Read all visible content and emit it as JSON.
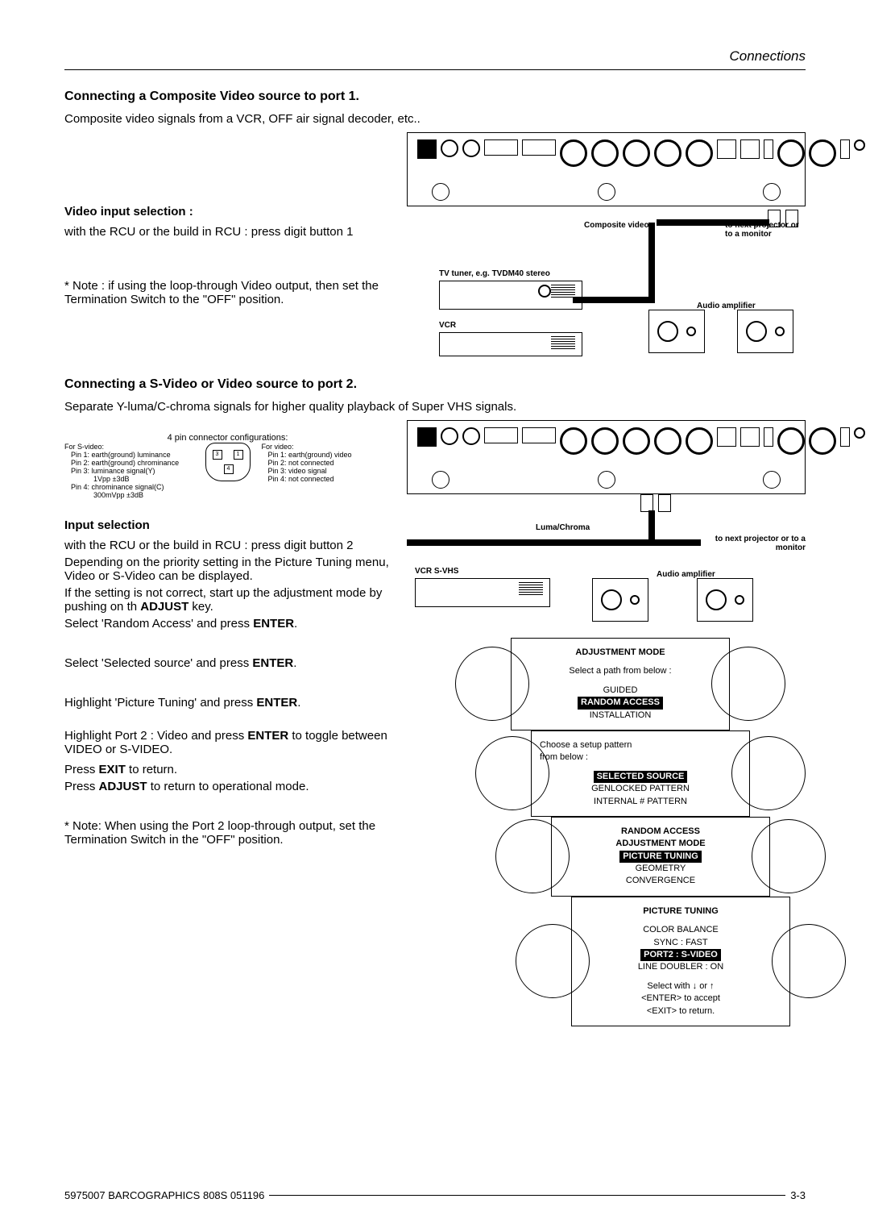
{
  "page": {
    "topic": "Connections",
    "footer_left": "5975007  BARCOGRAPHICS  808S  051196",
    "footer_right": "3-3"
  },
  "section1": {
    "heading": "Connecting a Composite Video source to port 1.",
    "intro": "Composite video signals from a VCR, OFF air signal decoder, etc..",
    "video_input_heading": "Video input selection :",
    "video_input_body": "with the RCU or the build in RCU : press digit button 1",
    "note": "* Note : if using the loop-through Video output, then set the Termination Switch to the \"OFF\" position."
  },
  "diagram1": {
    "composite_label": "Composite video",
    "to_next": "to next projector or to a monitor",
    "tuner_label": "TV tuner, e.g. TVDM40 stereo",
    "vcr_label": "VCR",
    "amp_label": "Audio amplifier"
  },
  "section2": {
    "heading": "Connecting a S-Video or Video source to port 2.",
    "intro": "Separate Y-luma/C-chroma signals for higher quality playback of Super VHS signals.",
    "pin_heading": "4 pin connector configurations:",
    "svideo_title": "For S-video:",
    "svideo_p1": "Pin 1: earth(ground) luminance",
    "svideo_p2": "Pin 2: earth(ground) chrominance",
    "svideo_p3a": "Pin 3:  luminance signal(Y)",
    "svideo_p3b": "1Vpp ±3dB",
    "svideo_p4a": "Pin 4:  chrominance signal(C)",
    "svideo_p4b": "300mVpp ±3dB",
    "video_title": "For video:",
    "video_p1": "Pin 1:  earth(ground) video",
    "video_p2": "Pin 2:  not connected",
    "video_p3": "Pin 3:  video signal",
    "video_p4": "Pin 4:  not connected",
    "input_sel_heading": "Input selection",
    "input_sel_body1": "with the RCU or the build in RCU : press digit button 2",
    "input_sel_body2": "Depending on the priority setting in the Picture Tuning menu, Video or S-Video can be displayed.",
    "input_sel_body3": "If the setting is not correct, start up the adjustment mode by pushing on th ",
    "adjust_key": "ADJUST",
    "input_sel_body3b": " key.",
    "input_sel_body4a": "Select 'Random Access' and press ",
    "enter": "ENTER",
    "step_sel_source": "Select  'Selected source' and press ",
    "step_pic_tuning": "Highlight 'Picture Tuning' and press ",
    "step_port2a": "Highlight Port 2 : Video and press ",
    "step_port2b": " to toggle between VIDEO or S-VIDEO.",
    "step_exit_a": "Press ",
    "exit": "EXIT",
    "step_exit_b": " to return.",
    "step_adjust_b": " to return to operational mode.",
    "note2": "* Note: When using the Port 2 loop-through output, set the Termination Switch in the \"OFF\" position."
  },
  "diagram2": {
    "luma_label": "Luma/Chroma",
    "to_next": "to next projector or to a monitor",
    "vcr_label": "VCR S-VHS",
    "amp_label": "Audio amplifier"
  },
  "osd1": {
    "title": "ADJUSTMENT  MODE",
    "line1": "Select a path from below :",
    "opt1": "GUIDED",
    "opt2": "RANDOM ACCESS",
    "opt3": "INSTALLATION"
  },
  "osd2": {
    "line1": "Choose a setup pattern",
    "line2": "from below :",
    "opt1": "SELECTED SOURCE",
    "opt2": "GENLOCKED PATTERN",
    "opt3": "INTERNAL # PATTERN"
  },
  "osd3": {
    "title1": "RANDOM ACCESS",
    "title2": "ADJUSTMENT MODE",
    "opt1": "PICTURE TUNING",
    "opt2": "GEOMETRY",
    "opt3": "CONVERGENCE"
  },
  "osd4": {
    "title": "PICTURE  TUNING",
    "opt1": "COLOR BALANCE",
    "opt2": "SYNC : FAST",
    "opt3": "PORT2 : S-VIDEO",
    "opt4": "LINE DOUBLER : ON",
    "hint1": "Select with  ↓  or  ↑",
    "hint2": "<ENTER> to accept",
    "hint3": "<EXIT> to return."
  }
}
